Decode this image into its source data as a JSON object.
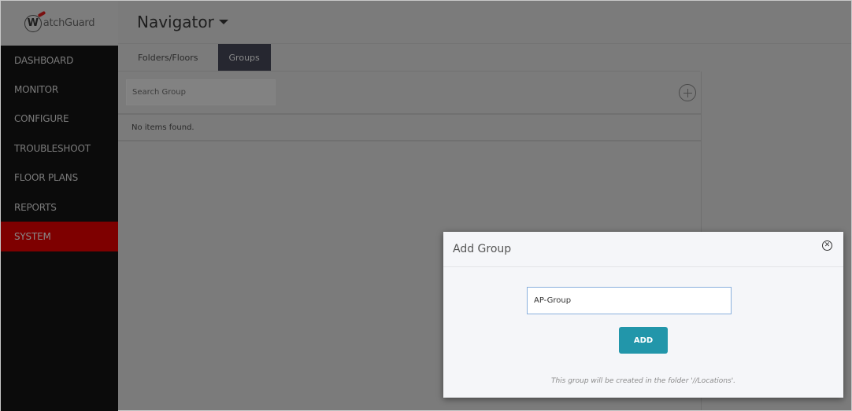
{
  "logo": {
    "text": "atchGuard",
    "mark": "W"
  },
  "sidebar": {
    "items": [
      {
        "label": "DASHBOARD",
        "active": false
      },
      {
        "label": "MONITOR",
        "active": false
      },
      {
        "label": "CONFIGURE",
        "active": false
      },
      {
        "label": "TROUBLESHOOT",
        "active": false
      },
      {
        "label": "FLOOR PLANS",
        "active": false
      },
      {
        "label": "REPORTS",
        "active": false
      },
      {
        "label": "SYSTEM",
        "active": true
      }
    ]
  },
  "header": {
    "title": "Navigator"
  },
  "tabs": [
    {
      "label": "Folders/Floors",
      "active": false
    },
    {
      "label": "Groups",
      "active": true
    }
  ],
  "search": {
    "placeholder": "Search Group",
    "value": ""
  },
  "list": {
    "empty_text": "No items found."
  },
  "modal": {
    "title": "Add Group",
    "input_value": "AP-Group",
    "add_label": "ADD",
    "hint": "This group will be created in the folder '//Locations'.",
    "close_symbol": "✕"
  },
  "colors": {
    "active_nav": "#7e0000",
    "add_button": "#2296aa",
    "active_tab": "#262730"
  }
}
